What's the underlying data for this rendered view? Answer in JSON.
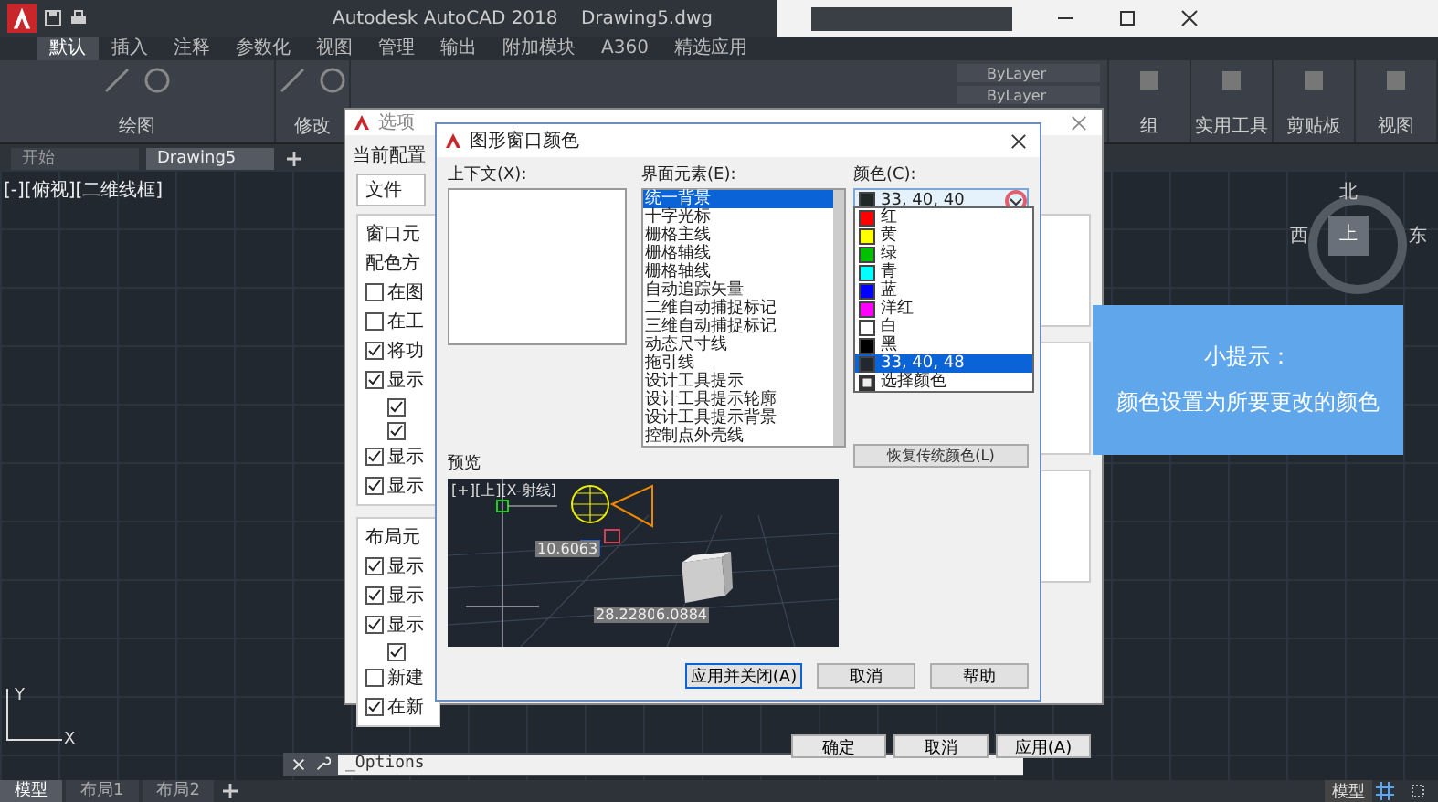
{
  "title_bar": {
    "title": "Autodesk AutoCAD 2018    Drawing5.dwg"
  },
  "ribbon_tabs": [
    {
      "label": "默认",
      "selected": true
    },
    {
      "label": "插入",
      "selected": false
    },
    {
      "label": "注释",
      "selected": false
    },
    {
      "label": "参数化",
      "selected": false
    },
    {
      "label": "视图",
      "selected": false
    },
    {
      "label": "管理",
      "selected": false
    },
    {
      "label": "输出",
      "selected": false
    },
    {
      "label": "附加模块",
      "selected": false
    },
    {
      "label": "A360",
      "selected": false
    },
    {
      "label": "精选应用",
      "selected": false
    }
  ],
  "ribbon_left_panels": [
    {
      "label": "绘图"
    },
    {
      "label": "修改"
    }
  ],
  "properties": [
    "ByLayer",
    "ByLayer"
  ],
  "ribbon_right_panels": [
    {
      "label": "组"
    },
    {
      "label": "实用工具"
    },
    {
      "label": "剪贴板"
    },
    {
      "label": "视图"
    }
  ],
  "file_tabs": [
    {
      "label": "开始",
      "selected": false
    },
    {
      "label": "Drawing5",
      "selected": true
    }
  ],
  "viewport": {
    "label": "[-][俯视][二维线框]",
    "compass": {
      "north": "北",
      "west": "西",
      "top": "上",
      "east": "东"
    },
    "ucs": {
      "x": "X",
      "y": "Y"
    }
  },
  "command_line": {
    "value": "_Options"
  },
  "layout_tabs": [
    {
      "label": "模型",
      "selected": true
    },
    {
      "label": "布局1",
      "selected": false
    },
    {
      "label": "布局2",
      "selected": false
    }
  ],
  "status_bar": {
    "model": "模型"
  },
  "options_dialog": {
    "title": "选项",
    "profile_label": "当前配置",
    "tab": "文件",
    "groups": [
      {
        "title": "窗口元",
        "items": [
          {
            "kind": "label",
            "label": "配色方"
          },
          {
            "kind": "check",
            "label": "在图",
            "checked": false
          },
          {
            "kind": "check",
            "label": "在工",
            "checked": false
          },
          {
            "kind": "check",
            "label": "将功",
            "checked": true
          },
          {
            "kind": "check",
            "label": "显示",
            "checked": true
          },
          {
            "kind": "sub",
            "checked": true
          },
          {
            "kind": "sub",
            "checked": true
          },
          {
            "kind": "check",
            "label": "显示",
            "checked": true
          },
          {
            "kind": "check",
            "label": "显示",
            "checked": true
          }
        ]
      },
      {
        "title": "布局元",
        "items": [
          {
            "kind": "check",
            "label": "显示",
            "checked": true
          },
          {
            "kind": "check",
            "label": "显示",
            "checked": true
          },
          {
            "kind": "check",
            "label": "显示",
            "checked": true
          },
          {
            "kind": "sub",
            "checked": true
          },
          {
            "kind": "check",
            "label": "新建",
            "checked": false
          },
          {
            "kind": "check",
            "label": "在新",
            "checked": true
          }
        ]
      }
    ],
    "buttons": [
      "确定",
      "取消",
      "应用(A)"
    ]
  },
  "color_dialog": {
    "title": "图形窗口颜色",
    "context_label": "上下文(X):",
    "elements_label": "界面元素(E):",
    "elements": [
      {
        "label": "统一背景",
        "selected": true
      },
      {
        "label": "十字光标",
        "selected": false
      },
      {
        "label": "栅格主线",
        "selected": false
      },
      {
        "label": "栅格辅线",
        "selected": false
      },
      {
        "label": "栅格轴线",
        "selected": false
      },
      {
        "label": "自动追踪矢量",
        "selected": false
      },
      {
        "label": "二维自动捕捉标记",
        "selected": false
      },
      {
        "label": "三维自动捕捉标记",
        "selected": false
      },
      {
        "label": "动态尺寸线",
        "selected": false
      },
      {
        "label": "拖引线",
        "selected": false
      },
      {
        "label": "设计工具提示",
        "selected": false
      },
      {
        "label": "设计工具提示轮廓",
        "selected": false
      },
      {
        "label": "设计工具提示背景",
        "selected": false
      },
      {
        "label": "控制点外壳线",
        "selected": false
      }
    ],
    "color_label": "颜色(C):",
    "color_value": {
      "label": "33, 40, 40",
      "color": "#212828"
    },
    "color_options": [
      {
        "kind": "swatch",
        "label": "红",
        "color": "#ff0000",
        "selected": false
      },
      {
        "kind": "swatch",
        "label": "黄",
        "color": "#ffff00",
        "selected": false
      },
      {
        "kind": "swatch",
        "label": "绿",
        "color": "#00c000",
        "selected": false
      },
      {
        "kind": "swatch",
        "label": "青",
        "color": "#00ffff",
        "selected": false
      },
      {
        "kind": "swatch",
        "label": "蓝",
        "color": "#0000ff",
        "selected": false
      },
      {
        "kind": "swatch",
        "label": "洋红",
        "color": "#ff00ff",
        "selected": false
      },
      {
        "kind": "swatch",
        "label": "白",
        "color": "#ffffff",
        "selected": false
      },
      {
        "kind": "swatch",
        "label": "黑",
        "color": "#000000",
        "selected": false
      },
      {
        "kind": "swatch",
        "label": "33, 40, 48",
        "color": "#212830",
        "selected": true
      },
      {
        "kind": "more",
        "label": "选择颜色",
        "selected": false
      }
    ],
    "restore_button": "恢复传统颜色(L)",
    "preview_label": "预览",
    "preview": {
      "view_label": "[+][上][X-射线]",
      "readouts": [
        "10.6063",
        "28.2280",
        "6.0884"
      ]
    },
    "buttons": [
      {
        "label": "应用并关闭(A)",
        "default": true
      },
      {
        "label": "取消",
        "default": false
      },
      {
        "label": "帮助",
        "default": false
      }
    ]
  },
  "tip": {
    "title": "小提示：",
    "text": "颜色设置为所要更改的颜色"
  }
}
